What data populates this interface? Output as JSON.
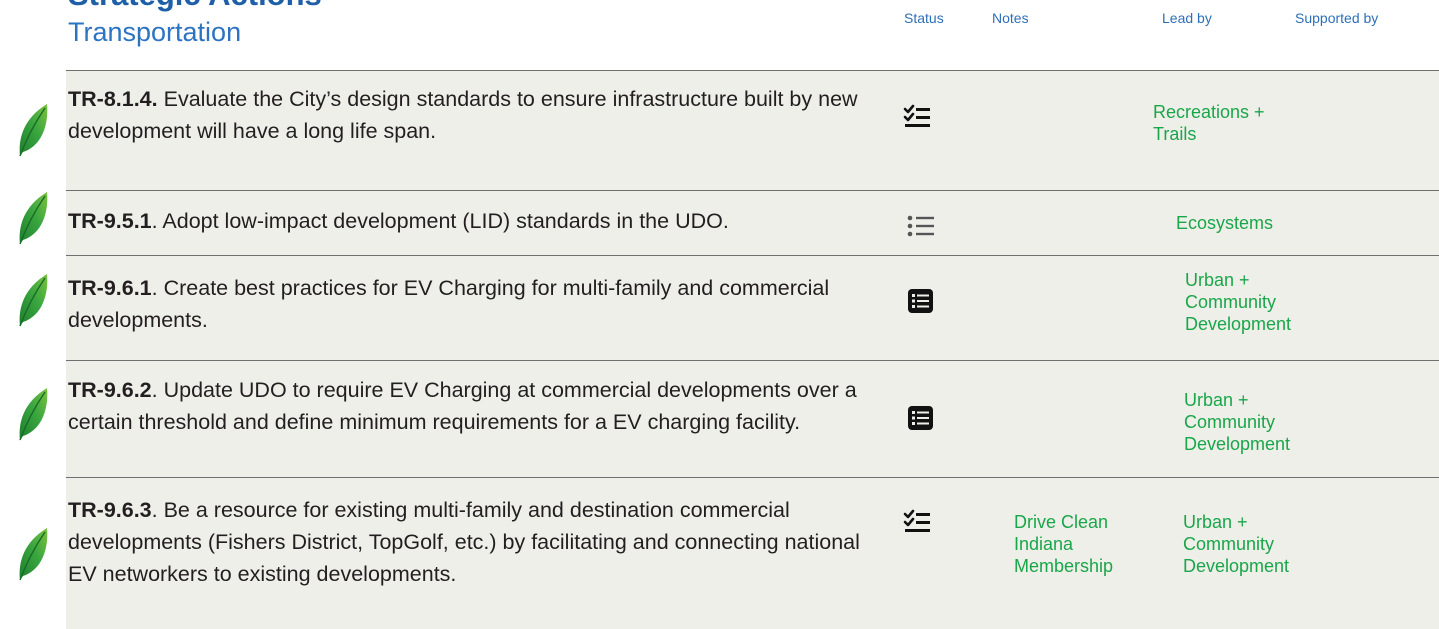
{
  "header": {
    "title": "Strategic Actions",
    "subtitle": "Transportation"
  },
  "columns": {
    "status": "Status",
    "notes": "Notes",
    "lead": "Lead by",
    "supported": "Supported by"
  },
  "rows": [
    {
      "code": "TR-8.1.4.",
      "text": " Evaluate the City’s design standards to ensure infrastructure built by new development will have a long life span.",
      "status_icon": "checklist-icon",
      "notes": "",
      "lead": "Recreations + Trails",
      "supported": ""
    },
    {
      "code": "TR-9.5.1",
      "text": ". Adopt low-impact development (LID) standards in the UDO.",
      "status_icon": "list-icon",
      "notes": "",
      "lead": "Ecosystems",
      "supported": ""
    },
    {
      "code": "TR-9.6.1",
      "text": ". Create best practices for EV Charging for multi-family and commercial developments.",
      "status_icon": "list-box-icon",
      "notes": "",
      "lead": "Urban + Community Development",
      "supported": ""
    },
    {
      "code": "TR-9.6.2",
      "text": ". Update UDO to require EV Charging at commercial developments over a certain threshold and define minimum requirements for a EV charging facility.",
      "status_icon": "list-box-icon",
      "notes": "",
      "lead": "Urban + Community Development",
      "supported": ""
    },
    {
      "code": "TR-9.6.3",
      "text": ". Be a resource for existing multi-family and destination commercial developments (Fishers District, TopGolf, etc.) by facilitating and connecting national EV networkers to existing developments.",
      "status_icon": "checklist-icon",
      "notes": "Drive Clean Indiana Membership",
      "lead": "Urban + Community Development",
      "supported": ""
    }
  ],
  "colors": {
    "heading": "#1f5fa8",
    "accent_green": "#1aa64a",
    "row_bg": "#eeefe9",
    "leaf": "#2e9a3c"
  }
}
